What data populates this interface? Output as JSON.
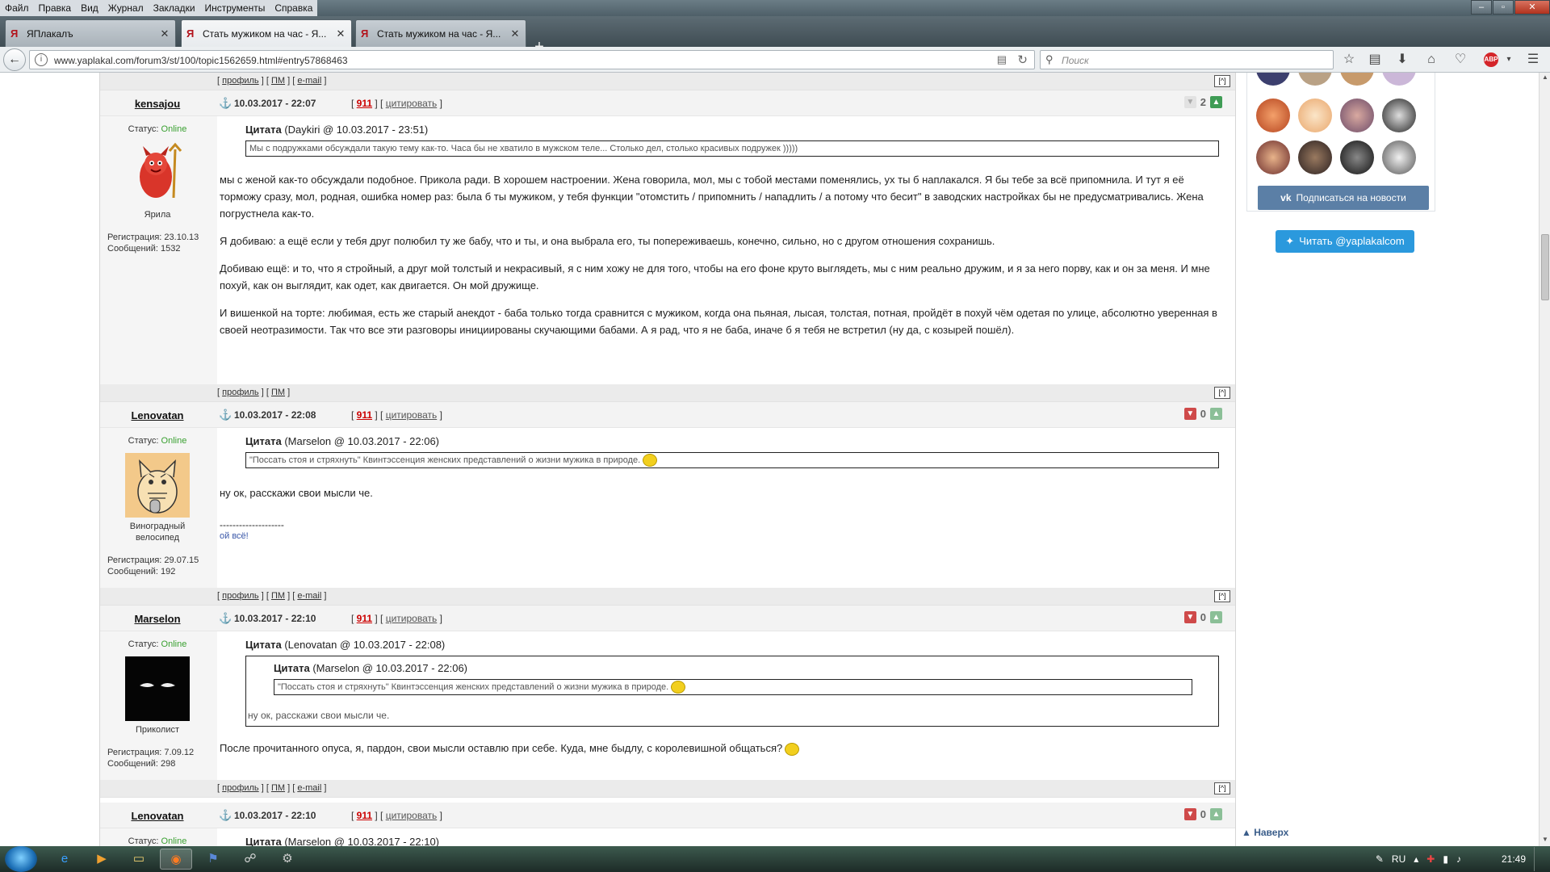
{
  "menubar": {
    "items": [
      "Файл",
      "Правка",
      "Вид",
      "Журнал",
      "Закладки",
      "Инструменты",
      "Справка"
    ]
  },
  "tabs": [
    {
      "title": "ЯПлакалъ",
      "active": false
    },
    {
      "title": "Стать мужиком на час - Я...",
      "active": true
    },
    {
      "title": "Стать мужиком на час - Я...",
      "active": false
    }
  ],
  "nav": {
    "url": "www.yaplakal.com/forum3/st/100/topic1562659.html#entry57868463",
    "search_placeholder": "Поиск",
    "abp": "ABP"
  },
  "bar_links": {
    "profile": "профиль",
    "pm": "ПМ",
    "email": "e-mail",
    "totop": "[^]"
  },
  "posts": [
    {
      "username": "kensajou",
      "date": "10.03.2017 - 22:07",
      "n911": "911",
      "quote_label": "цитировать",
      "rating": "2",
      "status_label": "Статус:",
      "status": "Online",
      "user_title": "Ярила",
      "reg": "Регистрация: 23.10.13",
      "msgs": "Сообщений: 1532",
      "quote": {
        "label": "Цитата",
        "src": "(Daykiri @ 10.03.2017 - 23:51)",
        "text": "Мы с подружками обсуждали такую тему как-то. Часа бы не хватило в мужском теле... Столько дел, столько красивых подружек )))))"
      },
      "paragraphs": [
        "мы с женой как-то обсуждали подобное. Прикола ради. В хорошем настроении. Жена говорила, мол, мы с тобой местами поменялись, ух ты б наплакался. Я бы тебе за всё припомнила. И тут я её торможу сразу, мол, родная, ошибка номер раз: была б ты мужиком, у тебя функции \"отомстить / припомнить / нападлить / а потому что бесит\" в заводских настройках бы не предусматривались. Жена погрустнела как-то.",
        "Я добиваю: а ещё если у тебя друг полюбил ту же бабу, что и ты, и она выбрала его, ты попереживаешь, конечно, сильно, но с другом отношения сохранишь.",
        "Добиваю ещё: и то, что я стройный, а друг мой толстый и некрасивый, я с ним хожу не для того, чтобы на его фоне круто выглядеть, мы с ним реально дружим, и я за него порву, как и он за меня. И мне похуй, как он выглядит, как одет, как двигается. Он мой дружище.",
        "И вишенкой на торте: любимая, есть же старый анекдот - баба только тогда сравнится с мужиком, когда она пьяная, лысая, толстая, потная, пройдёт в похуй чём одетая по улице, абсолютно уверенная в своей неотразимости. Так что все эти разговоры инициированы скучающими бабами. А я рад, что я не баба, иначе б я тебя не встретил (ну да, с козырей пошёл)."
      ]
    },
    {
      "username": "Lenovatan",
      "date": "10.03.2017 - 22:08",
      "n911": "911",
      "quote_label": "цитировать",
      "rating": "0",
      "status_label": "Статус:",
      "status": "Online",
      "user_title": "Виноградный велосипед",
      "reg": "Регистрация: 29.07.15",
      "msgs": "Сообщений: 192",
      "quote": {
        "label": "Цитата",
        "src": "(Marselon @ 10.03.2017 - 22:06)",
        "text": "\"Поссать стоя и стряхнуть\" Квинтэссенция женских представлений о жизни мужика в природе."
      },
      "paragraphs": [
        "ну ок, расскажи свои мысли че."
      ],
      "sig_line": "--------------------",
      "sig": "ой всё!"
    },
    {
      "username": "Marselon",
      "date": "10.03.2017 - 22:10",
      "n911": "911",
      "quote_label": "цитировать",
      "rating": "0",
      "status_label": "Статус:",
      "status": "Online",
      "user_title": "Приколист",
      "reg": "Регистрация: 7.09.12",
      "msgs": "Сообщений: 298",
      "quote": {
        "label": "Цитата",
        "src": "(Lenovatan @ 10.03.2017 - 22:08)",
        "inner_label": "Цитата",
        "inner_src": "(Marselon @ 10.03.2017 - 22:06)",
        "inner_text": "\"Поссать стоя и стряхнуть\" Квинтэссенция женских представлений о жизни мужика в природе.",
        "text": "ну ок, расскажи свои мысли че."
      },
      "paragraphs": [
        "После прочитанного опуса, я, пардон, свои мысли оставлю при себе. Куда, мне быдлу, с королевишной общаться?"
      ]
    },
    {
      "username": "Lenovatan",
      "date": "10.03.2017 - 22:10",
      "n911": "911",
      "quote_label": "цитировать",
      "rating": "0",
      "status_label": "Статус:",
      "status": "Online",
      "quote": {
        "label": "Цитата",
        "src": "(Marselon @ 10.03.2017 - 22:10)"
      }
    }
  ],
  "sidebar": {
    "vk_subscribe": "Подписаться на новости",
    "twitter": "Читать @yaplakalcom",
    "to_top": "Наверх"
  },
  "taskbar": {
    "lang": "RU",
    "time": "21:49"
  },
  "colors": {
    "online": "#39a030",
    "n911": "#cc0000",
    "vk": "#5b7fa6",
    "twitter": "#2b99dd"
  }
}
